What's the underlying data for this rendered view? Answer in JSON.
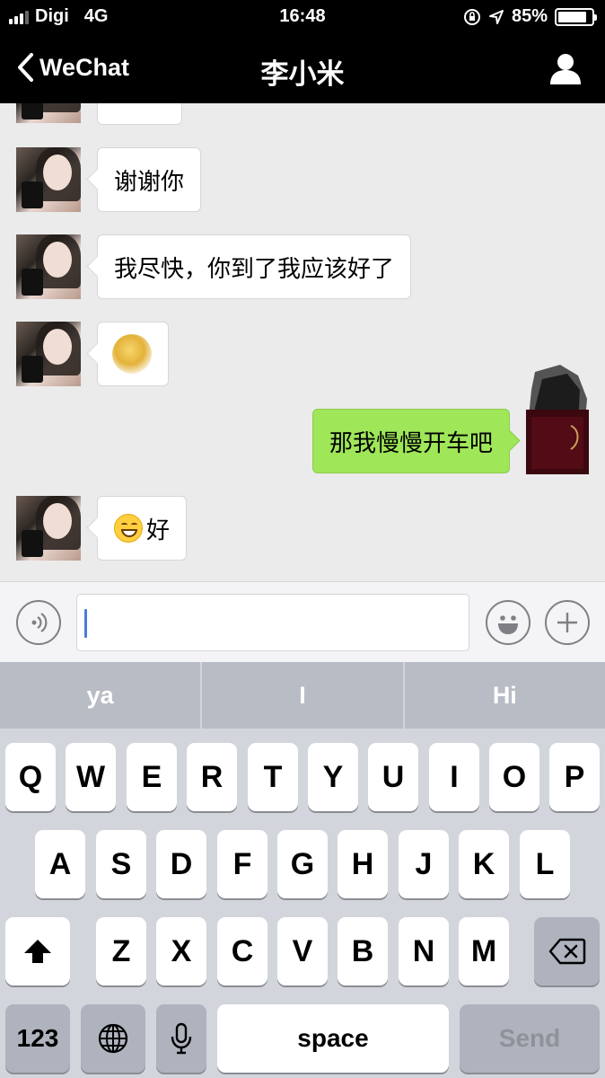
{
  "status_bar": {
    "carrier": "Digi",
    "network": "4G",
    "time": "16:48",
    "battery_percent": "85%",
    "battery_level": 0.85
  },
  "nav": {
    "back_label": "WeChat",
    "title": "李小米"
  },
  "messages": [
    {
      "side": "left",
      "text": "谢谢你"
    },
    {
      "side": "left",
      "text": "我尽快，你到了我应该好了"
    },
    {
      "side": "left",
      "kind": "sticker",
      "icon": "gold-glitter-sticker"
    },
    {
      "side": "right",
      "text": "那我慢慢开车吧"
    },
    {
      "side": "left",
      "emoji": "grinning-face-emoji",
      "text": "好"
    }
  ],
  "input": {
    "value": ""
  },
  "keyboard": {
    "suggestions": [
      "ya",
      "I",
      "Hi"
    ],
    "row1": [
      "Q",
      "W",
      "E",
      "R",
      "T",
      "Y",
      "U",
      "I",
      "O",
      "P"
    ],
    "row2": [
      "A",
      "S",
      "D",
      "F",
      "G",
      "H",
      "J",
      "K",
      "L"
    ],
    "row3": [
      "Z",
      "X",
      "C",
      "V",
      "B",
      "N",
      "M"
    ],
    "numbers_label": "123",
    "space_label": "space",
    "send_label": "Send"
  },
  "colors": {
    "outgoing_bubble": "#9fe659",
    "incoming_bubble": "#ffffff",
    "chat_background": "#ebebeb",
    "header": "#000000"
  }
}
